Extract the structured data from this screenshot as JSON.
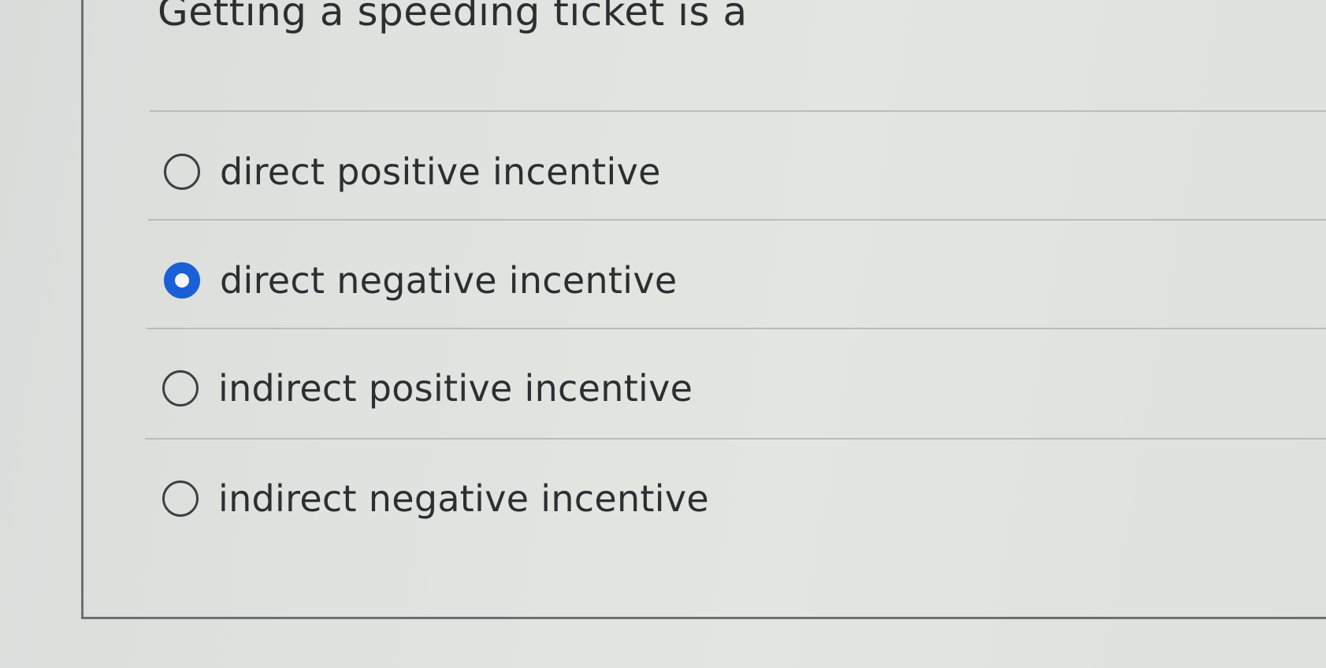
{
  "question": {
    "text": "Getting a speeding ticket is a"
  },
  "options": [
    {
      "label": "direct positive incentive",
      "selected": false
    },
    {
      "label": "direct negative incentive",
      "selected": true
    },
    {
      "label": "indirect positive incentive",
      "selected": false
    },
    {
      "label": "indirect negative incentive",
      "selected": false
    }
  ],
  "colors": {
    "selected_radio": "#1a5fd6",
    "text": "#2c2f31",
    "background": "#e0e2df"
  }
}
